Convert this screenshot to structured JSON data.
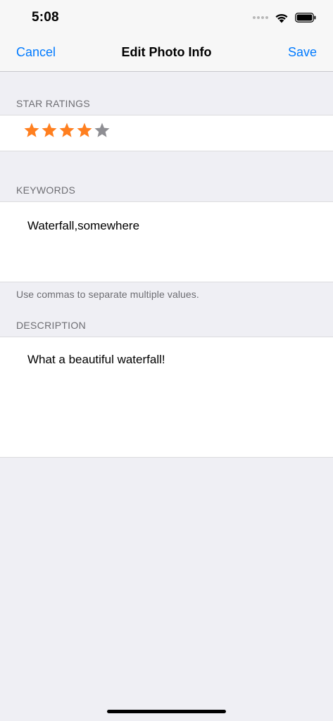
{
  "status_bar": {
    "time": "5:08",
    "icons": [
      "signal-icon",
      "wifi-icon",
      "battery-icon"
    ]
  },
  "nav": {
    "cancel_label": "Cancel",
    "title": "Edit Photo Info",
    "save_label": "Save"
  },
  "rating": {
    "header": "STAR RATINGS",
    "value": 4,
    "max": 5,
    "filled_color": "#ff7f1f",
    "empty_color": "#8e8e93"
  },
  "keywords": {
    "header": "KEYWORDS",
    "value": "Waterfall,somewhere",
    "footer": "Use commas to separate multiple values."
  },
  "description": {
    "header": "DESCRIPTION",
    "value": "What a beautiful waterfall!"
  },
  "colors": {
    "accent": "#007aff",
    "background": "#efeff4"
  }
}
